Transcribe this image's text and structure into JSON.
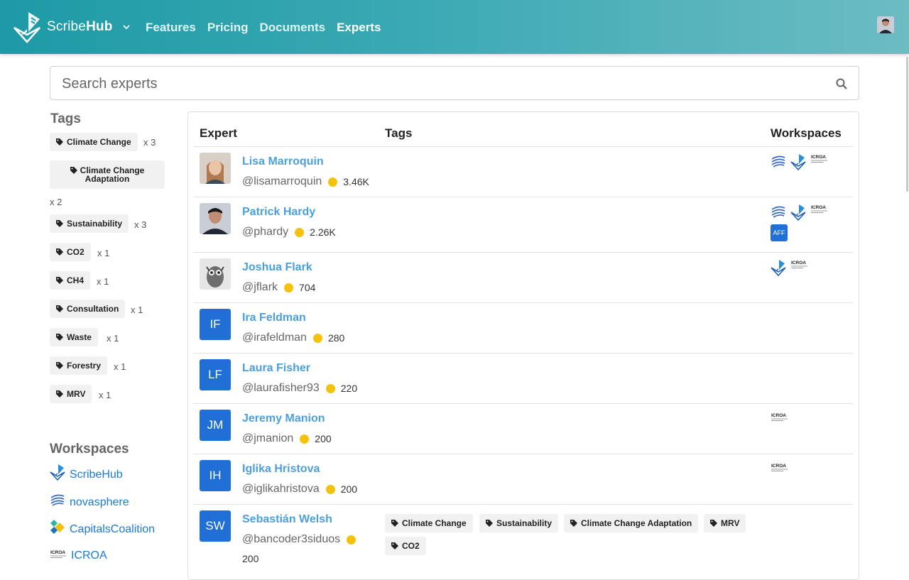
{
  "app": {
    "brand_prefix": "Scribe",
    "brand_suffix": "Hub"
  },
  "nav": {
    "items": [
      "Features",
      "Pricing",
      "Documents",
      "Experts"
    ],
    "active": "Experts"
  },
  "search": {
    "placeholder": "Search experts"
  },
  "sidebar": {
    "tags_title": "Tags",
    "tags": [
      {
        "label": "Climate Change",
        "count": "x 3"
      },
      {
        "label": "Climate Change Adaptation",
        "count": "x 2"
      },
      {
        "label": "Sustainability",
        "count": "x 3"
      },
      {
        "label": "CO2",
        "count": "x 1"
      },
      {
        "label": "CH4",
        "count": "x 1"
      },
      {
        "label": "Consultation",
        "count": "x 1"
      },
      {
        "label": "Waste",
        "count": "x 1"
      },
      {
        "label": "Forestry",
        "count": "x 1"
      },
      {
        "label": "MRV",
        "count": "x 1"
      }
    ],
    "workspaces_title": "Workspaces",
    "workspaces": [
      "ScribeHub",
      "novasphere",
      "CapitalsCoalition",
      "ICROA"
    ]
  },
  "table": {
    "headers": {
      "expert": "Expert",
      "tags": "Tags",
      "workspaces": "Workspaces"
    },
    "rows": [
      {
        "name": "Lisa Marroquin",
        "handle": "@lisamarroquin",
        "score": "3.46K",
        "initials": "",
        "workspaces": [
          "novasphere",
          "ScribeHub",
          "ICROA"
        ],
        "tags": []
      },
      {
        "name": "Patrick Hardy",
        "handle": "@phardy",
        "score": "2.26K",
        "initials": "",
        "workspaces": [
          "novasphere",
          "ScribeHub",
          "ICROA"
        ],
        "extra_badge": "AFF",
        "tags": []
      },
      {
        "name": "Joshua Flark",
        "handle": "@jflark",
        "score": "704",
        "initials": "",
        "workspaces": [
          "ScribeHub",
          "ICROA"
        ],
        "tags": []
      },
      {
        "name": "Ira Feldman",
        "handle": "@irafeldman",
        "score": "280",
        "initials": "IF",
        "workspaces": [],
        "tags": []
      },
      {
        "name": "Laura Fisher",
        "handle": "@laurafisher93",
        "score": "220",
        "initials": "LF",
        "workspaces": [],
        "tags": []
      },
      {
        "name": "Jeremy Manion",
        "handle": "@jmanion",
        "score": "200",
        "initials": "JM",
        "workspaces": [
          "ICROA"
        ],
        "tags": []
      },
      {
        "name": "Iglika Hristova",
        "handle": "@iglikahristova",
        "score": "200",
        "initials": "IH",
        "workspaces": [
          "ICROA"
        ],
        "tags": []
      },
      {
        "name": "Sebastián Welsh",
        "handle": "@bancoder3siduos",
        "score": "200",
        "initials": "SW",
        "workspaces": [],
        "tags": [
          "Climate Change",
          "Sustainability",
          "Climate Change Adaptation",
          "MRV",
          "CO2"
        ]
      }
    ]
  },
  "colors": {
    "header_start": "#1d9aa6",
    "header_end": "#6cbcc2",
    "link": "#4a9fdc",
    "initials_bg": "#1f6fd6",
    "coin": "#f4c20d"
  },
  "icons": {
    "search": "search-icon",
    "tag": "tag-icon",
    "caret": "chevron-down-icon"
  }
}
